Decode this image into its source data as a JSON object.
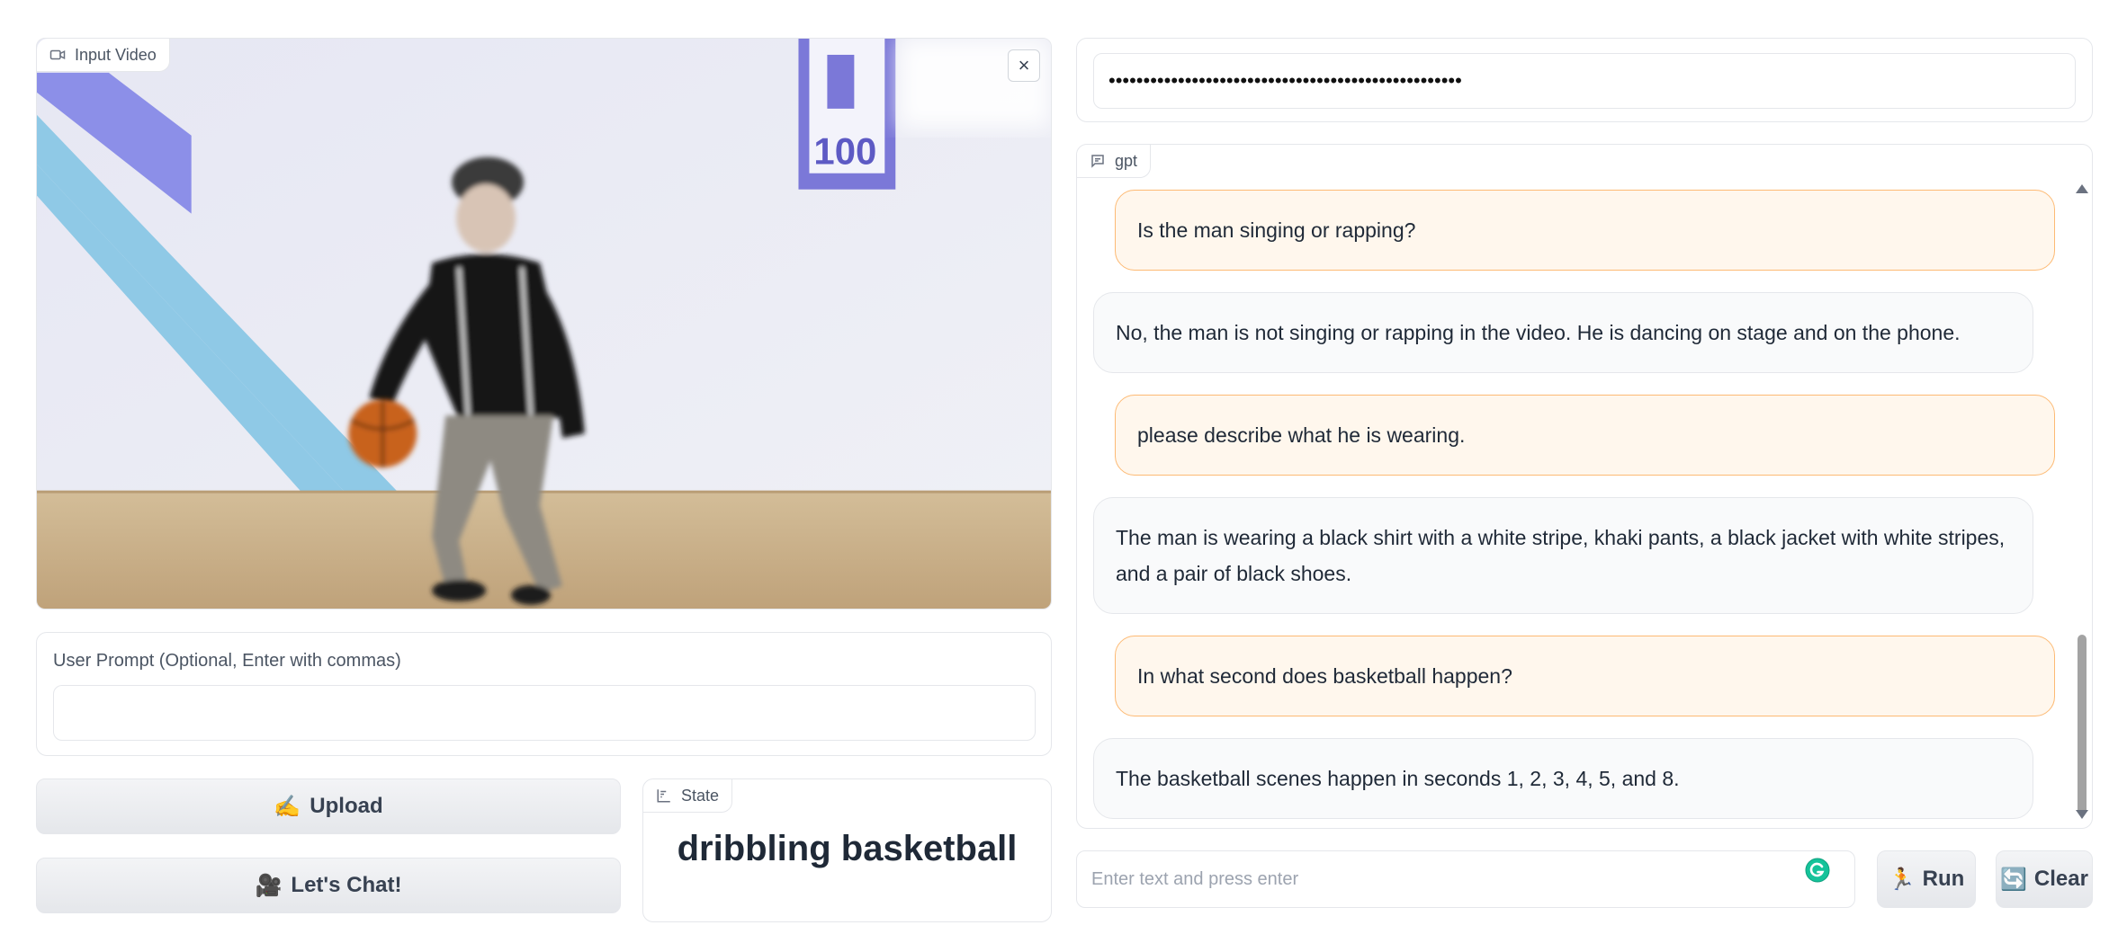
{
  "video": {
    "label": "Input Video",
    "close_glyph": "×",
    "icon": "video-camera-icon",
    "sign_text": "100",
    "colors": {
      "wall": "#eceef6",
      "floor": "#c9b08a",
      "stripe_blue": "#8fc9e6",
      "stripe_purple": "#8c8fe8",
      "sign": "#7b78d8"
    }
  },
  "prompt": {
    "label": "User Prompt (Optional, Enter with commas)",
    "value": "",
    "placeholder": ""
  },
  "buttons": {
    "upload_emoji": "✍️",
    "upload_label": "Upload",
    "chat_emoji": "🎥",
    "chat_label": "Let's Chat!",
    "run_emoji": "🏃",
    "run_label": "Run",
    "clear_emoji": "🔄",
    "clear_label": "Clear"
  },
  "state": {
    "label": "State",
    "value": "dribbling basketball",
    "icon": "bar-chart-icon"
  },
  "api_key": {
    "value": "•••••••••••••••••••••••••••••••••••••••••••••••••••"
  },
  "chat": {
    "label": "gpt",
    "icon": "chat-bubble-icon",
    "messages": [
      {
        "role": "user",
        "text": "Is the man singing or rapping?"
      },
      {
        "role": "bot",
        "text": "No, the man is not singing or rapping in the video. He is dancing on stage and on the phone."
      },
      {
        "role": "user",
        "text": "please describe what he is wearing."
      },
      {
        "role": "bot",
        "text": "The man is wearing a black shirt with a white stripe, khaki pants, a black jacket with white stripes, and a pair of black shoes."
      },
      {
        "role": "user",
        "text": "In what second does basketball happen?"
      },
      {
        "role": "bot",
        "text": "The basketball scenes happen in seconds 1, 2, 3, 4, 5, and 8."
      }
    ]
  },
  "input": {
    "placeholder": "Enter text and press enter",
    "value": ""
  },
  "colors": {
    "user_bubble": "#fff7ed",
    "user_border": "#fdba74",
    "bot_bubble": "#f9fafb",
    "grammarly": "#15c39a"
  }
}
